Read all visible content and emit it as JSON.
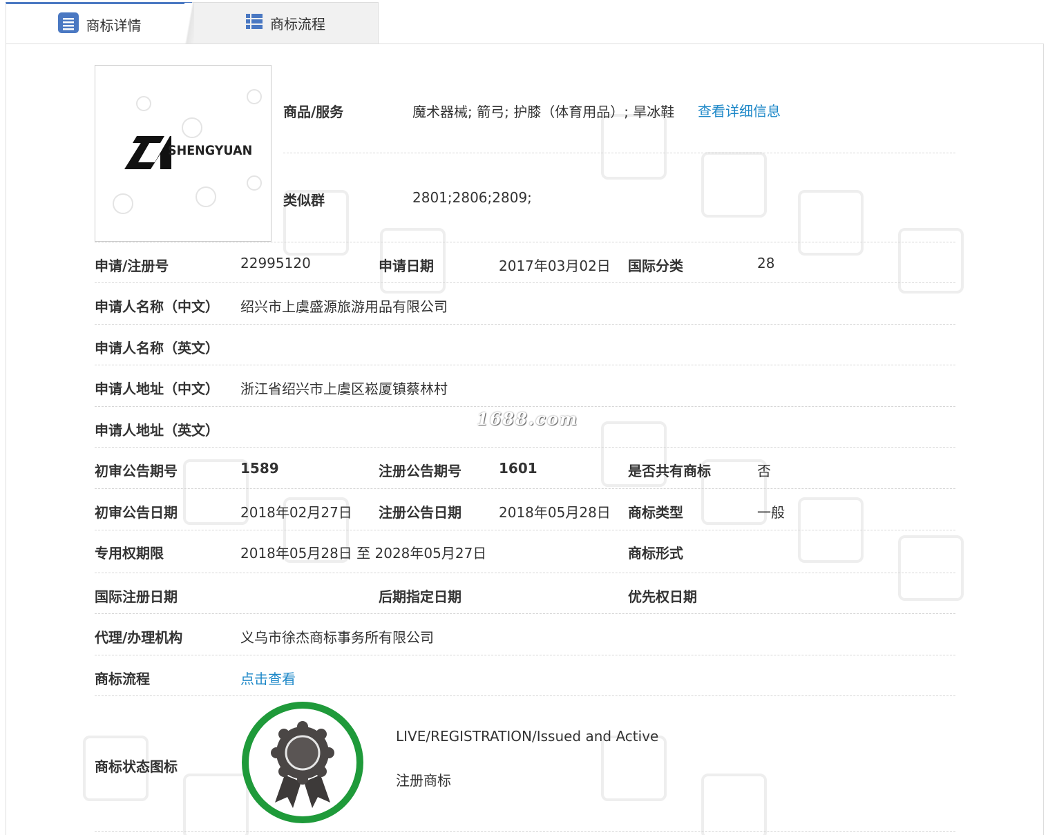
{
  "tabs": {
    "detail_label": "商标详情",
    "flow_label": "商标流程"
  },
  "mark": {
    "logo_text": "SHENGYUAN"
  },
  "goods": {
    "label": "商品/服务",
    "value": "魔术器械; 箭弓; 护膝（体育用品）; 旱冰鞋",
    "link": "查看详细信息"
  },
  "similar_group": {
    "label": "类似群",
    "value": "2801;2806;2809;"
  },
  "rows": {
    "reg_no_label": "申请/注册号",
    "reg_no": "22995120",
    "apply_date_label": "申请日期",
    "apply_date": "2017年03月02日",
    "intl_class_label": "国际分类",
    "intl_class": "28",
    "applicant_cn_label": "申请人名称（中文）",
    "applicant_cn": "绍兴市上虞盛源旅游用品有限公司",
    "applicant_en_label": "申请人名称（英文）",
    "address_cn_label": "申请人地址（中文）",
    "address_cn": "浙江省绍兴市上虞区崧厦镇蔡林村",
    "address_en_label": "申请人地址（英文）",
    "prelim_no_label": "初审公告期号",
    "prelim_no": "1589",
    "reg_pub_no_label": "注册公告期号",
    "reg_pub_no": "1601",
    "shared_label": "是否共有商标",
    "shared": "否",
    "prelim_date_label": "初审公告日期",
    "prelim_date": "2018年02月27日",
    "reg_pub_date_label": "注册公告日期",
    "reg_pub_date": "2018年05月28日",
    "mark_type_label": "商标类型",
    "mark_type": "一般",
    "term_label": "专用权期限",
    "term": "2018年05月28日 至 2028年05月27日",
    "mark_form_label": "商标形式",
    "intl_reg_date_label": "国际注册日期",
    "later_date_label": "后期指定日期",
    "priority_date_label": "优先权日期",
    "agent_label": "代理/办理机构",
    "agent": "义乌市徐杰商标事务所有限公司",
    "flow_label": "商标流程",
    "flow_link": "点击查看",
    "status_icon_label": "商标状态图标"
  },
  "status": {
    "en": "LIVE/REGISTRATION/Issued and Active",
    "cn": "注册商标"
  },
  "watermark_site": "1688.com",
  "colors": {
    "tab_accent": "#4a78c2",
    "link": "#1e88c8",
    "badge_green": "#1f9a3a"
  }
}
